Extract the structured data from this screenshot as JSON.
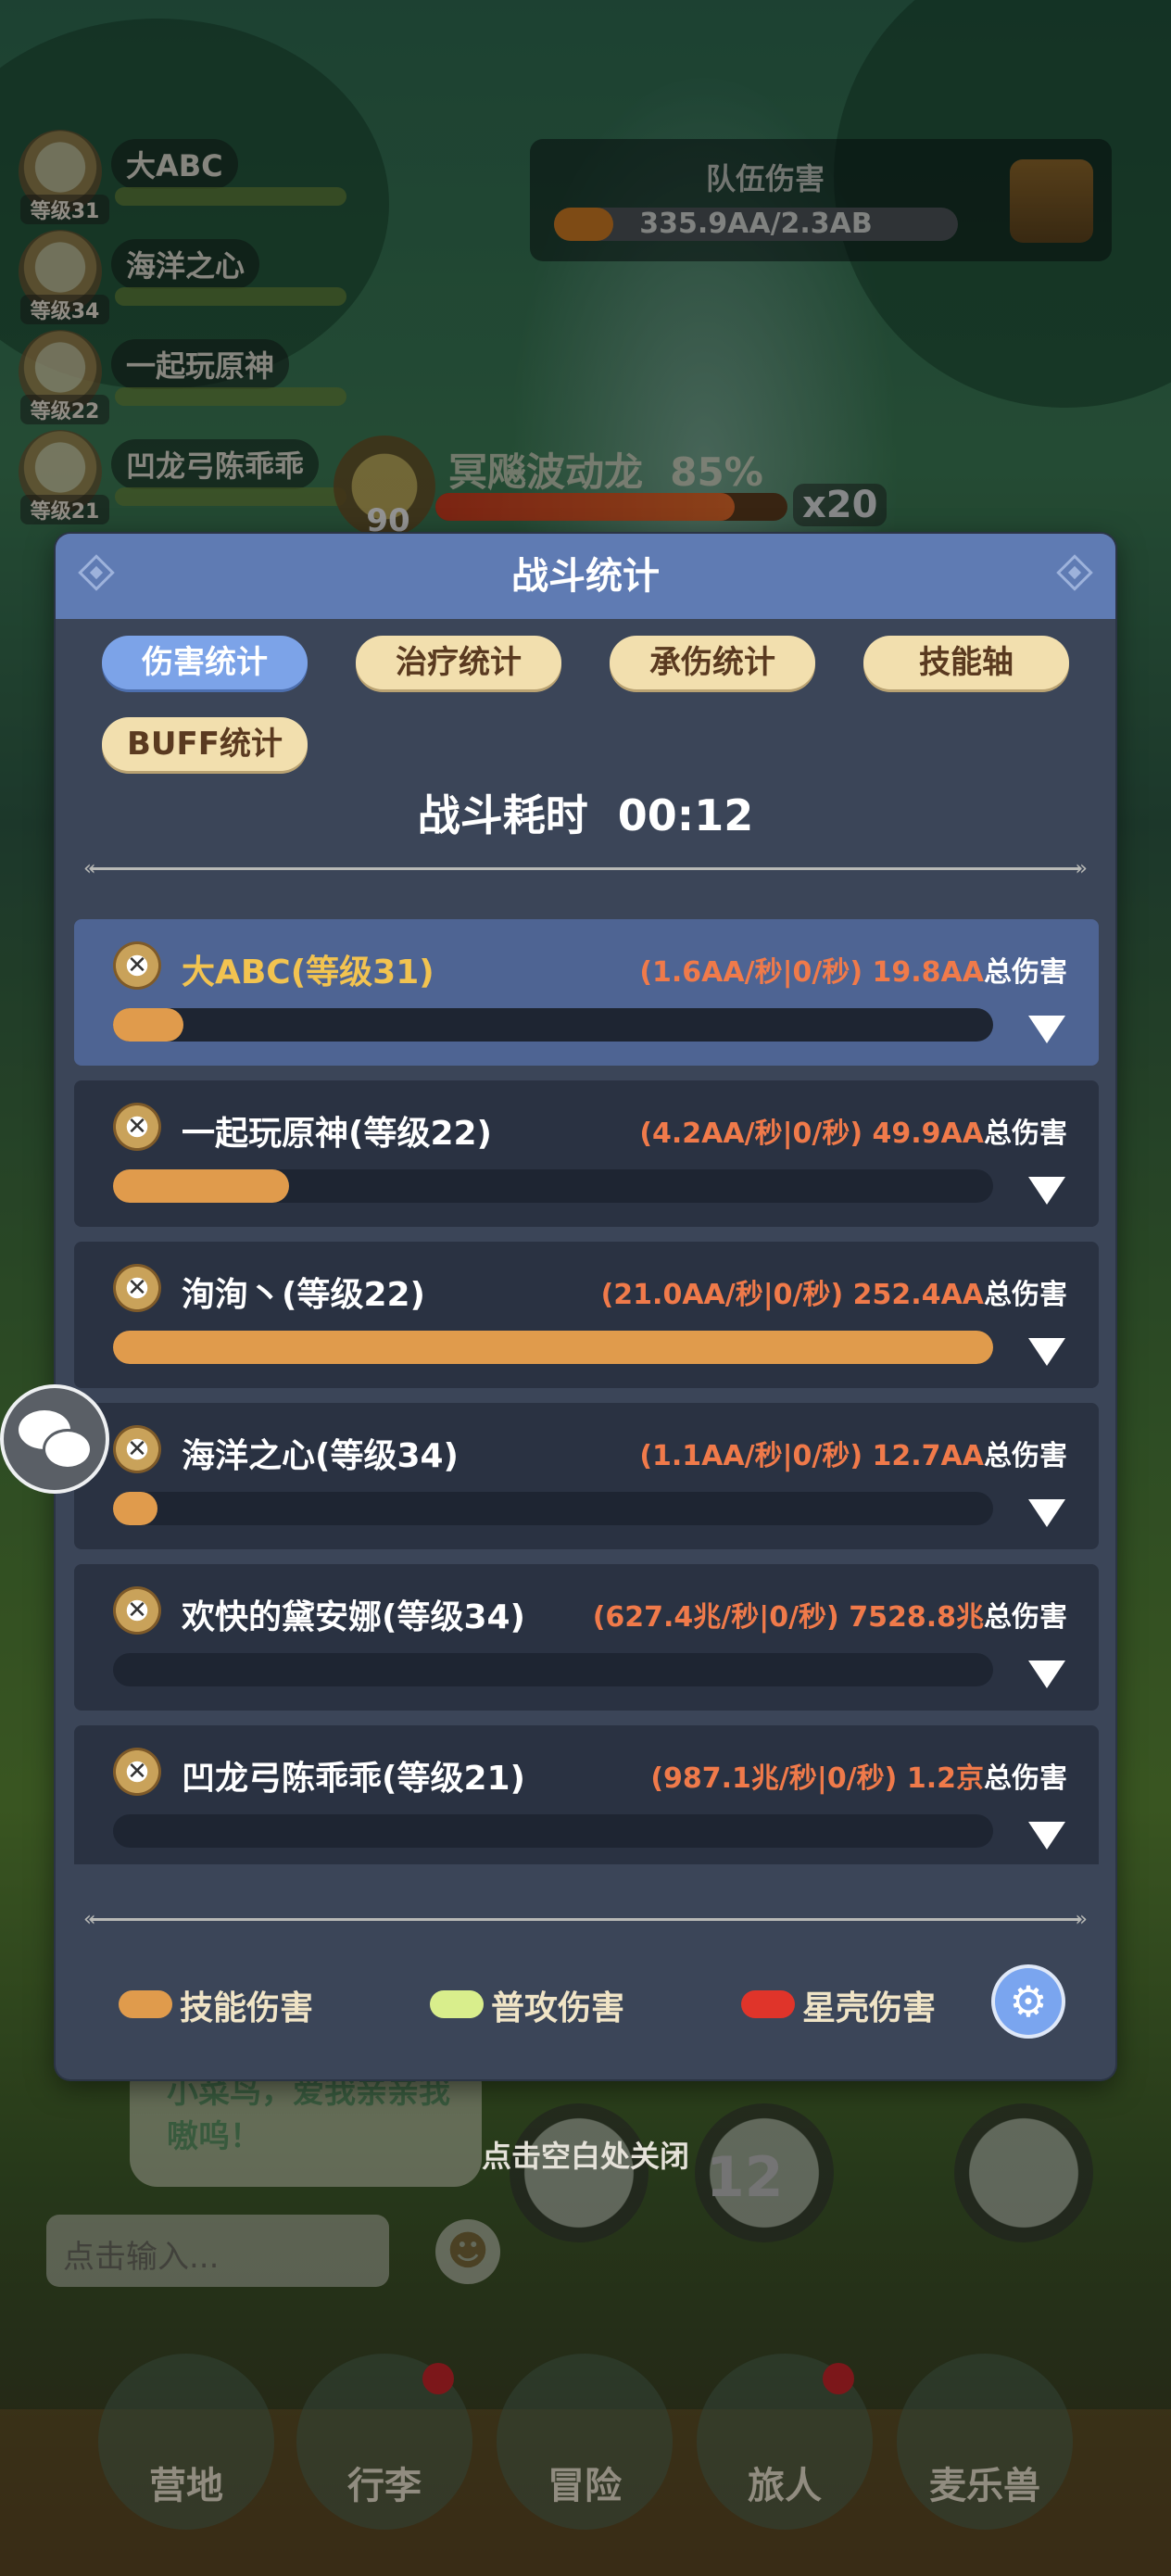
{
  "scene": {
    "team": [
      {
        "name": "大ABC",
        "level": "等级31"
      },
      {
        "name": "海洋之心",
        "level": "等级34"
      },
      {
        "name": "一起玩原神",
        "level": "等级22"
      },
      {
        "name": "凹龙弓陈乖乖",
        "level": "等级21"
      }
    ],
    "team_damage": {
      "title": "队伍伤害",
      "value": "335.9AA/2.3AB",
      "progress": 0.146
    },
    "boss": {
      "name": "冥飚波动龙",
      "percent": "85%",
      "level": "90",
      "multiplier": "x20"
    },
    "chat_bubble": "小菜鸟，爱我亲亲我嗷呜！",
    "input_placeholder": "点击输入...",
    "emoji_icon": "☻",
    "skill_number": "12",
    "nav": [
      {
        "label": "营地",
        "badge": false
      },
      {
        "label": "行李",
        "badge": true
      },
      {
        "label": "冒险",
        "badge": false
      },
      {
        "label": "旅人",
        "badge": true
      },
      {
        "label": "麦乐兽",
        "badge": false
      }
    ],
    "close_hint": "点击空白处关闭"
  },
  "modal": {
    "title": "战斗统计",
    "tabs": [
      {
        "label": "伤害统计",
        "active": true
      },
      {
        "label": "治疗统计",
        "active": false
      },
      {
        "label": "承伤统计",
        "active": false
      },
      {
        "label": "技能轴",
        "active": false
      },
      {
        "label": "BUFF统计",
        "active": false
      }
    ],
    "battle_time_label": "战斗耗时",
    "battle_time": "00:12",
    "rows": [
      {
        "name": "大ABC(等级31)",
        "rate": "(1.6AA/秒|0/秒)",
        "total": "19.8AA",
        "suffix": "总伤害",
        "skill_fraction": 0.08,
        "highlight": true
      },
      {
        "name": "一起玩原神(等级22)",
        "rate": "(4.2AA/秒|0/秒)",
        "total": "49.9AA",
        "suffix": "总伤害",
        "skill_fraction": 0.2,
        "highlight": false
      },
      {
        "name": "洵洵丶(等级22)",
        "rate": "(21.0AA/秒|0/秒)",
        "total": "252.4AA",
        "suffix": "总伤害",
        "skill_fraction": 1.0,
        "highlight": false
      },
      {
        "name": "海洋之心(等级34)",
        "rate": "(1.1AA/秒|0/秒)",
        "total": "12.7AA",
        "suffix": "总伤害",
        "skill_fraction": 0.05,
        "highlight": false
      },
      {
        "name": "欢快的黛安娜(等级34)",
        "rate": "(627.4兆/秒|0/秒)",
        "total": "7528.8兆",
        "suffix": "总伤害",
        "skill_fraction": 0.0,
        "highlight": false
      },
      {
        "name": "凹龙弓陈乖乖(等级21)",
        "rate": "(987.1兆/秒|0/秒)",
        "total": "1.2京",
        "suffix": "总伤害",
        "skill_fraction": 0.0,
        "highlight": false
      }
    ],
    "legend": [
      {
        "label": "技能伤害",
        "color": "#e09b4c"
      },
      {
        "label": "普攻伤害",
        "color": "#d9ee8c"
      },
      {
        "label": "星壳伤害",
        "color": "#e0342a"
      }
    ],
    "settings_icon": "⚙"
  }
}
